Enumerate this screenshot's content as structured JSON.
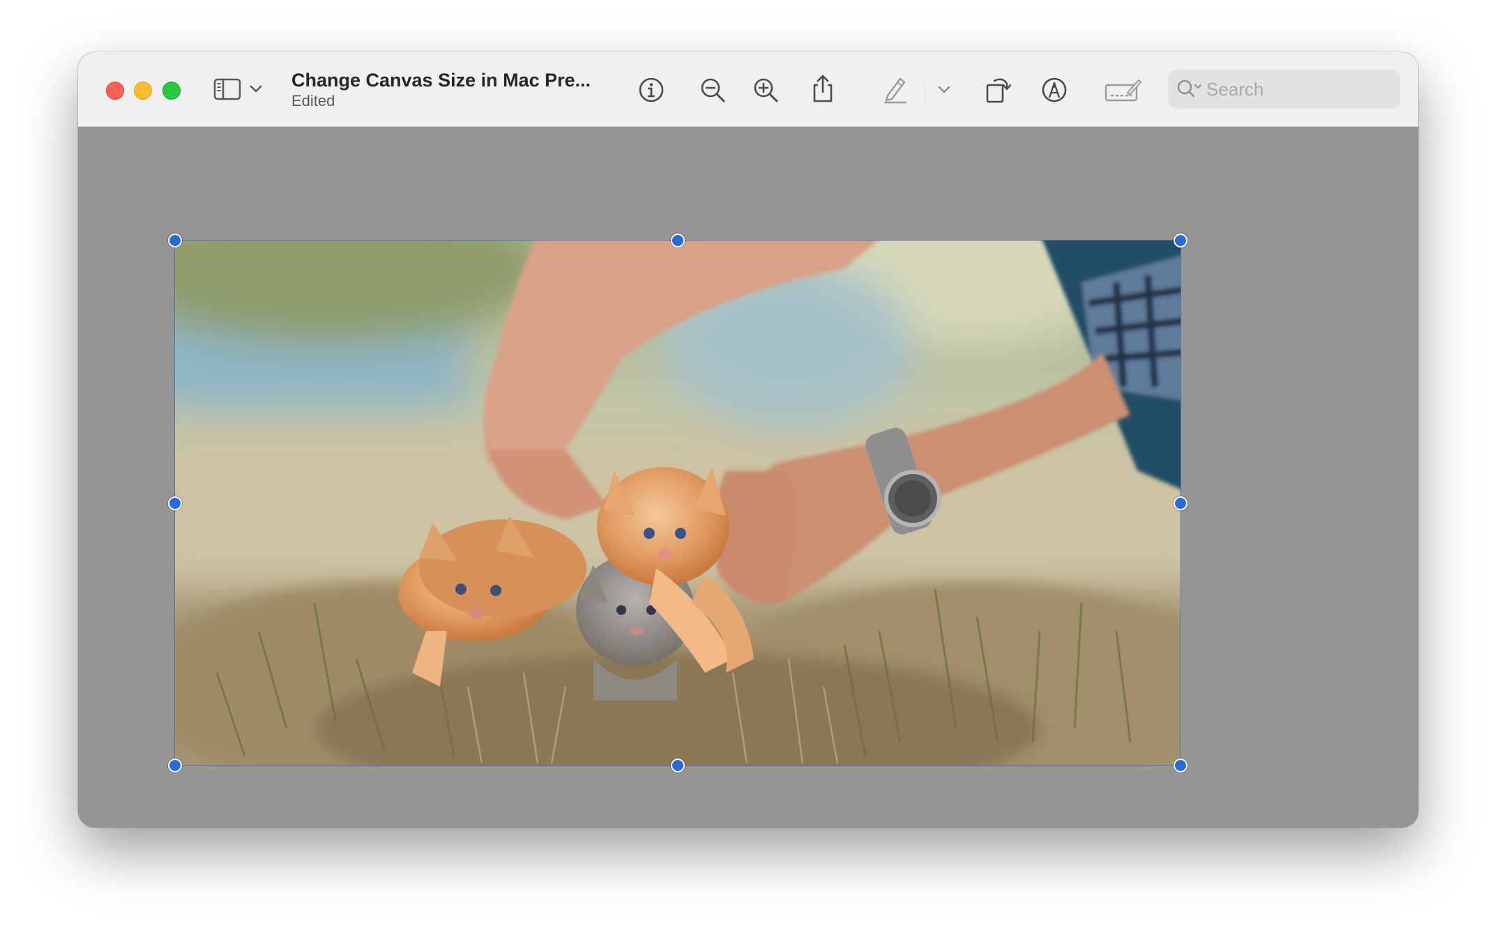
{
  "window": {
    "title": "Change Canvas Size in Mac Pre...",
    "subtitle": "Edited"
  },
  "toolbar": {
    "icons": [
      "sidebar-icon",
      "chevron-down-icon",
      "info-icon",
      "zoom-out-icon",
      "zoom-in-icon",
      "share-icon",
      "markup-pen-icon",
      "chevron-down-icon",
      "rotate-icon",
      "annotate-icon",
      "signature-icon",
      "search-icon"
    ]
  },
  "search": {
    "placeholder": "Search"
  },
  "colors": {
    "close": "#fe5f57",
    "minimize": "#febc2e",
    "maximize": "#28c840",
    "selection_handle": "#2a6ad6",
    "canvas_background": "#959595"
  }
}
